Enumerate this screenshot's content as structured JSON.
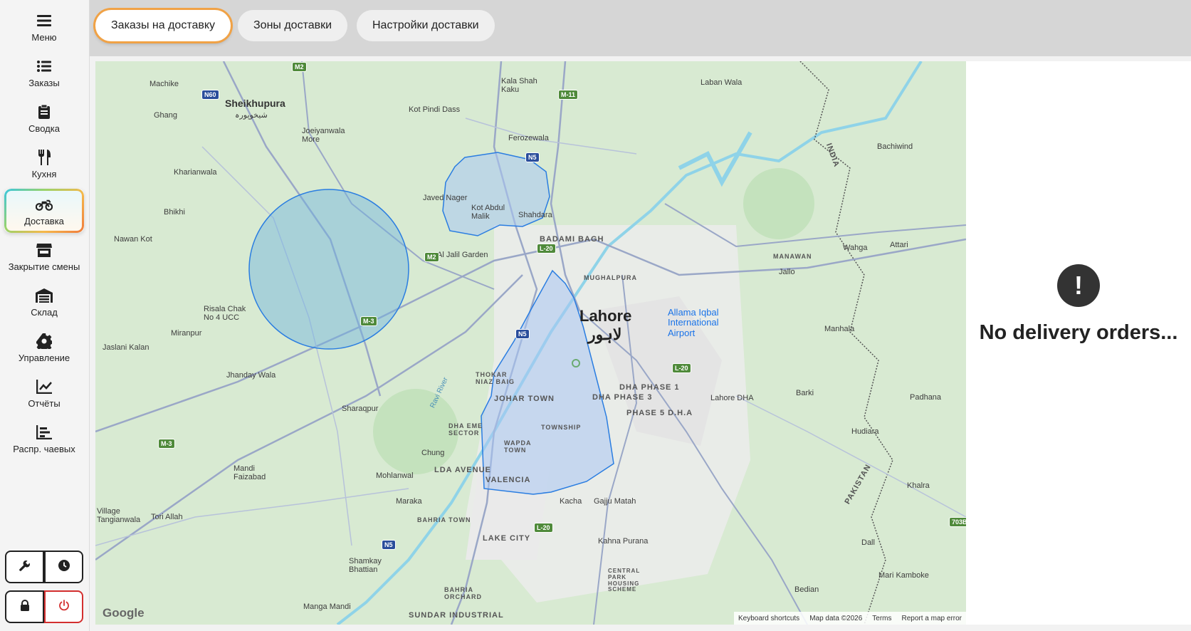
{
  "sidebar": {
    "items": [
      {
        "label": "Меню",
        "icon": "menu-icon"
      },
      {
        "label": "Заказы",
        "icon": "orders-list-icon"
      },
      {
        "label": "Сводка",
        "icon": "clipboard-icon"
      },
      {
        "label": "Кухня",
        "icon": "fork-knife-icon"
      },
      {
        "label": "Доставка",
        "icon": "motorcycle-icon"
      },
      {
        "label": "Закрытие смены",
        "icon": "store-icon"
      },
      {
        "label": "Склад",
        "icon": "warehouse-icon"
      },
      {
        "label": "Управление",
        "icon": "gear-icon"
      },
      {
        "label": "Отчёты",
        "icon": "line-chart-icon"
      },
      {
        "label": "Распр. чаевых",
        "icon": "bar-chart-icon"
      }
    ],
    "active_item": "Доставка"
  },
  "tabs": [
    {
      "label": "Заказы на доставку",
      "active": true
    },
    {
      "label": "Зоны доставки",
      "active": false
    },
    {
      "label": "Настройки доставки",
      "active": false
    }
  ],
  "map": {
    "labels": {
      "sheikhupura": "Sheikhupura",
      "sheikhupura_ur": "شیخوپورہ",
      "lahore": "Lahore",
      "lahore_ur": "لاہور",
      "machike": "Machike",
      "ghang": "Ghang",
      "joeiyanwala": "Joeiyanwala More",
      "kharianwala": "Kharianwala",
      "bhikhi": "Bhikhi",
      "nawan_kot": "Nawan Kot",
      "risala_chak": "Risala Chak No 4 UCC",
      "miranpur": "Miranpur",
      "jaslani_kalan": "Jaslani Kalan",
      "jhanday_wala": "Jhanday Wala",
      "sharaqpur": "Sharaqpur",
      "mandi_faizabad": "Mandi Faizabad",
      "village_tangianwala": "Village Tangianwala",
      "tori_allah": "Tori Allah",
      "kot_pindi_dass": "Kot Pindi Dass",
      "kala_shah_kaku": "Kala Shah Kaku",
      "ferozewala": "Ferozewala",
      "javed_nager": "Javed Nager",
      "kot_abdul_malik": "Kot Abdul Malik",
      "shahdara": "Shahdara",
      "al_jalil_garden": "Al Jalil Garden",
      "badami_bagh": "BADAMI BAGH",
      "mughalpura": "MUGHALPURA",
      "thokar_niaz_baig": "THOKAR NIAZ BAIG",
      "johar_town": "JOHAR TOWN",
      "township": "TOWNSHIP",
      "wapda_town": "WAPDA TOWN",
      "dha_eme": "DHA EME SECTOR",
      "chung": "Chung",
      "lda_avenue": "LDA AVENUE",
      "valencia": "VALENCIA",
      "mohlanwal": "Mohlanwal",
      "maraka": "Maraka",
      "bahria_town": "BAHRIA TOWN",
      "kacha": "Kacha",
      "gajju_matah": "Gajju Matah",
      "lake_city": "LAKE CITY",
      "kahna_purana": "Kahna Purana",
      "central_park": "CENTRAL PARK HOUSING SCHEME",
      "bahria_orchard": "BAHRIA ORCHARD",
      "shamkay_bhattian": "Shamkay Bhattian",
      "manga_mandi": "Manga Mandi",
      "sundar_industrial": "SUNDAR INDUSTRIAL",
      "dha_phase1": "DHA PHASE 1",
      "dha_phase3": "DHA PHASE 3",
      "phase5": "PHASE 5 D.H.A",
      "lahore_dha": "Lahore DHA",
      "airport": "Allama Iqbal International Airport",
      "laban_wala": "Laban Wala",
      "bachiwind": "Bachiwind",
      "wahga": "Wahga",
      "attari": "Attari",
      "manawan": "MANAWAN",
      "jallo": "Jallo",
      "manhala": "Manhala",
      "barki": "Barki",
      "hudiara": "Hudiara",
      "padhana": "Padhana",
      "khalra": "Khalra",
      "dall": "Dall",
      "mari_kamboke": "Mari Kamboke",
      "bedian": "Bedian",
      "india": "INDIA",
      "pakistan": "PAKISTAN",
      "ravi_river": "Ravi River"
    },
    "shields": [
      "M2",
      "N60",
      "M-11",
      "N5",
      "L-20",
      "M-3",
      "M2",
      "N5",
      "L-20",
      "M-3",
      "N5",
      "L-20",
      "703B"
    ],
    "google": "Google",
    "footer": {
      "keyboard": "Keyboard shortcuts",
      "data": "Map data ©2026",
      "terms": "Terms",
      "report": "Report a map error"
    }
  },
  "empty_state": {
    "icon": "!",
    "message": "No delivery orders..."
  }
}
